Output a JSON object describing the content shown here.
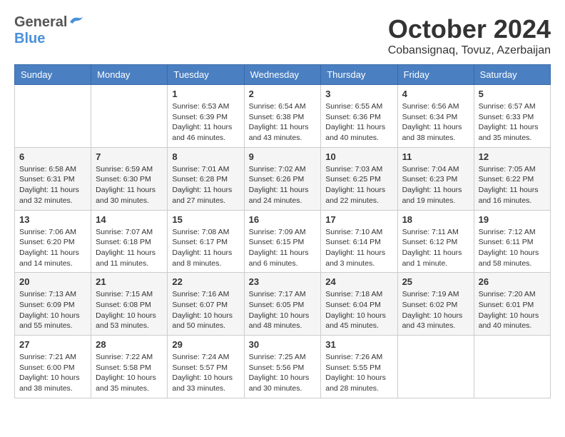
{
  "header": {
    "logo": {
      "general": "General",
      "blue": "Blue"
    },
    "title": "October 2024",
    "subtitle": "Cobansignaq, Tovuz, Azerbaijan"
  },
  "weekdays": [
    "Sunday",
    "Monday",
    "Tuesday",
    "Wednesday",
    "Thursday",
    "Friday",
    "Saturday"
  ],
  "weeks": [
    [
      {
        "day": "",
        "info": ""
      },
      {
        "day": "",
        "info": ""
      },
      {
        "day": "1",
        "sunrise": "Sunrise: 6:53 AM",
        "sunset": "Sunset: 6:39 PM",
        "daylight": "Daylight: 11 hours and 46 minutes."
      },
      {
        "day": "2",
        "sunrise": "Sunrise: 6:54 AM",
        "sunset": "Sunset: 6:38 PM",
        "daylight": "Daylight: 11 hours and 43 minutes."
      },
      {
        "day": "3",
        "sunrise": "Sunrise: 6:55 AM",
        "sunset": "Sunset: 6:36 PM",
        "daylight": "Daylight: 11 hours and 40 minutes."
      },
      {
        "day": "4",
        "sunrise": "Sunrise: 6:56 AM",
        "sunset": "Sunset: 6:34 PM",
        "daylight": "Daylight: 11 hours and 38 minutes."
      },
      {
        "day": "5",
        "sunrise": "Sunrise: 6:57 AM",
        "sunset": "Sunset: 6:33 PM",
        "daylight": "Daylight: 11 hours and 35 minutes."
      }
    ],
    [
      {
        "day": "6",
        "sunrise": "Sunrise: 6:58 AM",
        "sunset": "Sunset: 6:31 PM",
        "daylight": "Daylight: 11 hours and 32 minutes."
      },
      {
        "day": "7",
        "sunrise": "Sunrise: 6:59 AM",
        "sunset": "Sunset: 6:30 PM",
        "daylight": "Daylight: 11 hours and 30 minutes."
      },
      {
        "day": "8",
        "sunrise": "Sunrise: 7:01 AM",
        "sunset": "Sunset: 6:28 PM",
        "daylight": "Daylight: 11 hours and 27 minutes."
      },
      {
        "day": "9",
        "sunrise": "Sunrise: 7:02 AM",
        "sunset": "Sunset: 6:26 PM",
        "daylight": "Daylight: 11 hours and 24 minutes."
      },
      {
        "day": "10",
        "sunrise": "Sunrise: 7:03 AM",
        "sunset": "Sunset: 6:25 PM",
        "daylight": "Daylight: 11 hours and 22 minutes."
      },
      {
        "day": "11",
        "sunrise": "Sunrise: 7:04 AM",
        "sunset": "Sunset: 6:23 PM",
        "daylight": "Daylight: 11 hours and 19 minutes."
      },
      {
        "day": "12",
        "sunrise": "Sunrise: 7:05 AM",
        "sunset": "Sunset: 6:22 PM",
        "daylight": "Daylight: 11 hours and 16 minutes."
      }
    ],
    [
      {
        "day": "13",
        "sunrise": "Sunrise: 7:06 AM",
        "sunset": "Sunset: 6:20 PM",
        "daylight": "Daylight: 11 hours and 14 minutes."
      },
      {
        "day": "14",
        "sunrise": "Sunrise: 7:07 AM",
        "sunset": "Sunset: 6:18 PM",
        "daylight": "Daylight: 11 hours and 11 minutes."
      },
      {
        "day": "15",
        "sunrise": "Sunrise: 7:08 AM",
        "sunset": "Sunset: 6:17 PM",
        "daylight": "Daylight: 11 hours and 8 minutes."
      },
      {
        "day": "16",
        "sunrise": "Sunrise: 7:09 AM",
        "sunset": "Sunset: 6:15 PM",
        "daylight": "Daylight: 11 hours and 6 minutes."
      },
      {
        "day": "17",
        "sunrise": "Sunrise: 7:10 AM",
        "sunset": "Sunset: 6:14 PM",
        "daylight": "Daylight: 11 hours and 3 minutes."
      },
      {
        "day": "18",
        "sunrise": "Sunrise: 7:11 AM",
        "sunset": "Sunset: 6:12 PM",
        "daylight": "Daylight: 11 hours and 1 minute."
      },
      {
        "day": "19",
        "sunrise": "Sunrise: 7:12 AM",
        "sunset": "Sunset: 6:11 PM",
        "daylight": "Daylight: 10 hours and 58 minutes."
      }
    ],
    [
      {
        "day": "20",
        "sunrise": "Sunrise: 7:13 AM",
        "sunset": "Sunset: 6:09 PM",
        "daylight": "Daylight: 10 hours and 55 minutes."
      },
      {
        "day": "21",
        "sunrise": "Sunrise: 7:15 AM",
        "sunset": "Sunset: 6:08 PM",
        "daylight": "Daylight: 10 hours and 53 minutes."
      },
      {
        "day": "22",
        "sunrise": "Sunrise: 7:16 AM",
        "sunset": "Sunset: 6:07 PM",
        "daylight": "Daylight: 10 hours and 50 minutes."
      },
      {
        "day": "23",
        "sunrise": "Sunrise: 7:17 AM",
        "sunset": "Sunset: 6:05 PM",
        "daylight": "Daylight: 10 hours and 48 minutes."
      },
      {
        "day": "24",
        "sunrise": "Sunrise: 7:18 AM",
        "sunset": "Sunset: 6:04 PM",
        "daylight": "Daylight: 10 hours and 45 minutes."
      },
      {
        "day": "25",
        "sunrise": "Sunrise: 7:19 AM",
        "sunset": "Sunset: 6:02 PM",
        "daylight": "Daylight: 10 hours and 43 minutes."
      },
      {
        "day": "26",
        "sunrise": "Sunrise: 7:20 AM",
        "sunset": "Sunset: 6:01 PM",
        "daylight": "Daylight: 10 hours and 40 minutes."
      }
    ],
    [
      {
        "day": "27",
        "sunrise": "Sunrise: 7:21 AM",
        "sunset": "Sunset: 6:00 PM",
        "daylight": "Daylight: 10 hours and 38 minutes."
      },
      {
        "day": "28",
        "sunrise": "Sunrise: 7:22 AM",
        "sunset": "Sunset: 5:58 PM",
        "daylight": "Daylight: 10 hours and 35 minutes."
      },
      {
        "day": "29",
        "sunrise": "Sunrise: 7:24 AM",
        "sunset": "Sunset: 5:57 PM",
        "daylight": "Daylight: 10 hours and 33 minutes."
      },
      {
        "day": "30",
        "sunrise": "Sunrise: 7:25 AM",
        "sunset": "Sunset: 5:56 PM",
        "daylight": "Daylight: 10 hours and 30 minutes."
      },
      {
        "day": "31",
        "sunrise": "Sunrise: 7:26 AM",
        "sunset": "Sunset: 5:55 PM",
        "daylight": "Daylight: 10 hours and 28 minutes."
      },
      {
        "day": "",
        "info": ""
      },
      {
        "day": "",
        "info": ""
      }
    ]
  ]
}
